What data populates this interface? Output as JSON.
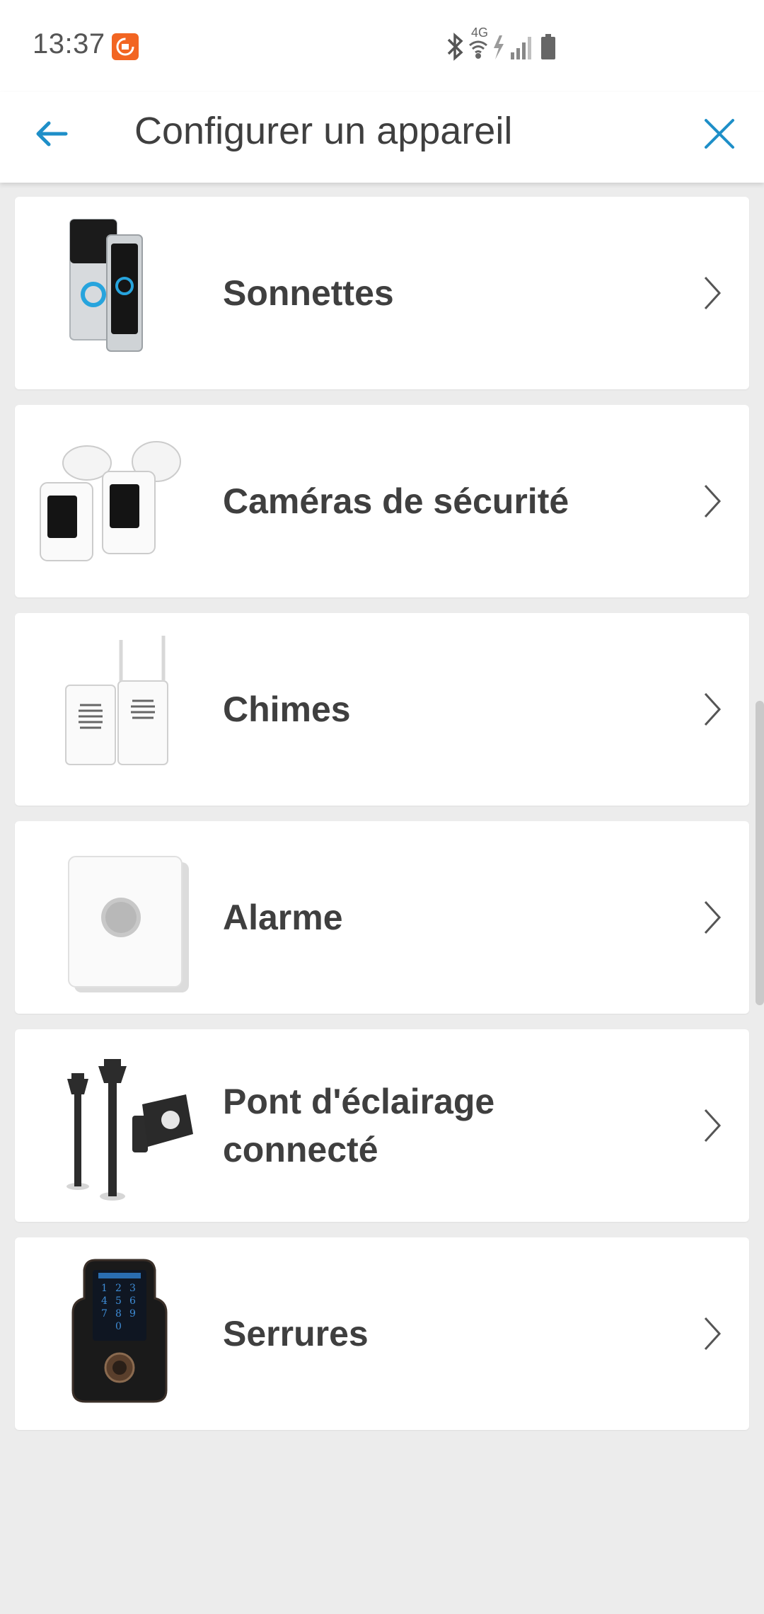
{
  "status_bar": {
    "time": "13:37",
    "network": "4G",
    "icons": [
      "bluetooth-icon",
      "wifi-icon",
      "signal-icon",
      "battery-icon"
    ]
  },
  "header": {
    "title": "Configurer un appareil",
    "back_icon": "arrow-left-icon",
    "close_icon": "close-icon"
  },
  "colors": {
    "accent": "#1e8fc8",
    "background": "#ececec",
    "card": "#ffffff",
    "text": "#3f3f3f"
  },
  "devices": [
    {
      "label": "Sonnettes",
      "icon": "doorbell-icon"
    },
    {
      "label": "Caméras de sécurité",
      "icon": "security-camera-icon"
    },
    {
      "label": "Chimes",
      "icon": "chime-icon"
    },
    {
      "label": "Alarme",
      "icon": "alarm-icon"
    },
    {
      "label": "Pont d'éclairage connecté",
      "icon": "smart-lighting-bridge-icon"
    },
    {
      "label": "Serrures",
      "icon": "lock-icon"
    }
  ]
}
